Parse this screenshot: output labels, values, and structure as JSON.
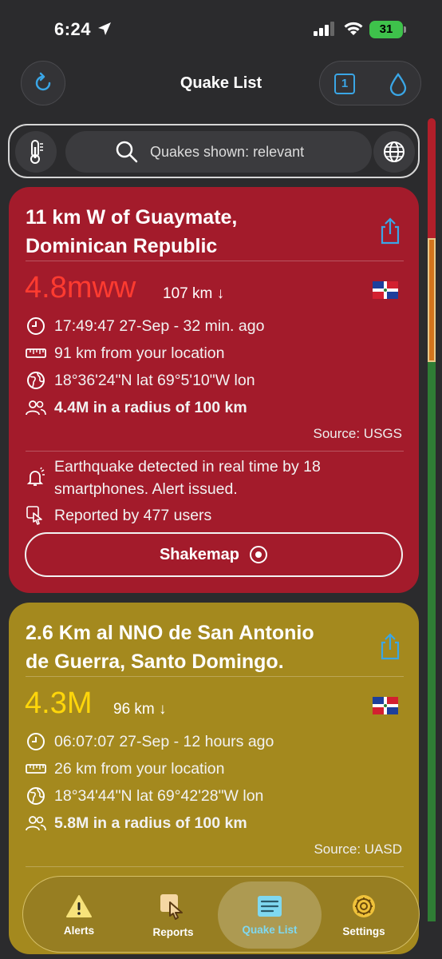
{
  "status_bar": {
    "time": "6:24",
    "battery": "31"
  },
  "nav": {
    "title": "Quake List",
    "count_badge": "1"
  },
  "search": {
    "label": "Quakes shown: relevant"
  },
  "quakes": [
    {
      "title_line1": "11 km W of Guaymate,",
      "title_line2": "Dominican Republic",
      "magnitude": "4.8mww",
      "magnitude_color": "#ff3b30",
      "depth": "107 km ↓",
      "time": "17:49:47 27-Sep - 32 min. ago",
      "distance": "91 km from your location",
      "coords": "18°36'24\"N lat 69°5'10\"W lon",
      "population": "4.4M in a radius of 100 km",
      "source": "Source: USGS",
      "alert_line1": "Earthquake detected in real time by 18",
      "alert_line2": "smartphones. Alert issued.",
      "reported": "Reported by 477 users",
      "shakemap_label": "Shakemap"
    },
    {
      "title_line1": "2.6 Km al NNO de San Antonio",
      "title_line2": "de Guerra, Santo Domingo.",
      "magnitude": "4.3M",
      "magnitude_color": "#ffd60a",
      "depth": "96 km ↓",
      "time": "06:07:07 27-Sep - 12 hours ago",
      "distance": "26 km from your location",
      "coords": "18°34'44\"N lat 69°42'28\"W lon",
      "population": "5.8M in a radius of 100 km",
      "source": "Source: UASD"
    }
  ],
  "tabs": [
    {
      "label": "Alerts",
      "icon": "warning-icon"
    },
    {
      "label": "Reports",
      "icon": "tap-hand-icon"
    },
    {
      "label": "Quake List",
      "icon": "list-icon",
      "active": true
    },
    {
      "label": "Settings",
      "icon": "gear-icon"
    }
  ],
  "colors": {
    "card_red": "#a31b2b",
    "card_yellow": "#a4891e",
    "accent_blue": "#3aa6e6",
    "scroll_red": "#b21f2a",
    "scroll_orange": "#d2741c",
    "scroll_green": "#2f7d35"
  }
}
